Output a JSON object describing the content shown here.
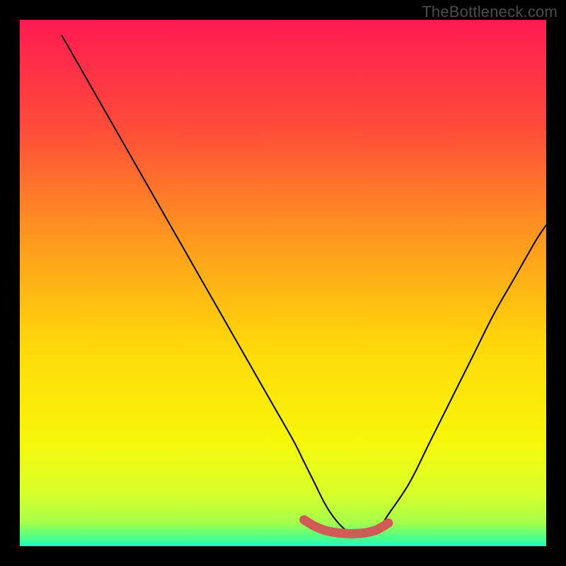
{
  "watermark": "TheBottleneck.com",
  "chart_data": {
    "type": "line",
    "title": "",
    "xlabel": "",
    "ylabel": "",
    "xlim": [
      0,
      100
    ],
    "ylim": [
      0,
      100
    ],
    "grid": false,
    "legend": false,
    "curve": {
      "name": "bottleneck-curve",
      "color": "#000000",
      "x": [
        8,
        12,
        16,
        20,
        24,
        28,
        32,
        36,
        40,
        44,
        48,
        52,
        54,
        56,
        58,
        60,
        62,
        64,
        66,
        68,
        70,
        74,
        78,
        82,
        86,
        90,
        94,
        98,
        100
      ],
      "y": [
        97,
        90,
        83,
        76,
        69,
        62,
        55,
        48,
        41,
        34,
        27,
        20,
        16,
        12,
        8,
        5,
        3,
        2.2,
        2.2,
        3,
        6,
        12,
        20,
        28,
        36,
        44,
        51,
        58,
        61
      ]
    },
    "trough_marker": {
      "name": "optimal-band",
      "color": "#d15a57",
      "x": [
        54,
        56,
        58,
        60,
        62,
        64,
        66,
        68,
        70
      ],
      "y": [
        5.0,
        3.8,
        3.0,
        2.6,
        2.4,
        2.4,
        2.6,
        3.2,
        4.4
      ]
    },
    "background_gradient": {
      "type": "vertical",
      "stops": [
        {
          "pos": 0.0,
          "color": "#ff1a52"
        },
        {
          "pos": 0.2,
          "color": "#ff4a3a"
        },
        {
          "pos": 0.42,
          "color": "#ff9a1e"
        },
        {
          "pos": 0.62,
          "color": "#ffd80a"
        },
        {
          "pos": 0.8,
          "color": "#f7f70a"
        },
        {
          "pos": 0.9,
          "color": "#d8ff2a"
        },
        {
          "pos": 0.955,
          "color": "#a6ff4a"
        },
        {
          "pos": 0.985,
          "color": "#4aff8c"
        },
        {
          "pos": 1.0,
          "color": "#1affc0"
        }
      ]
    }
  }
}
